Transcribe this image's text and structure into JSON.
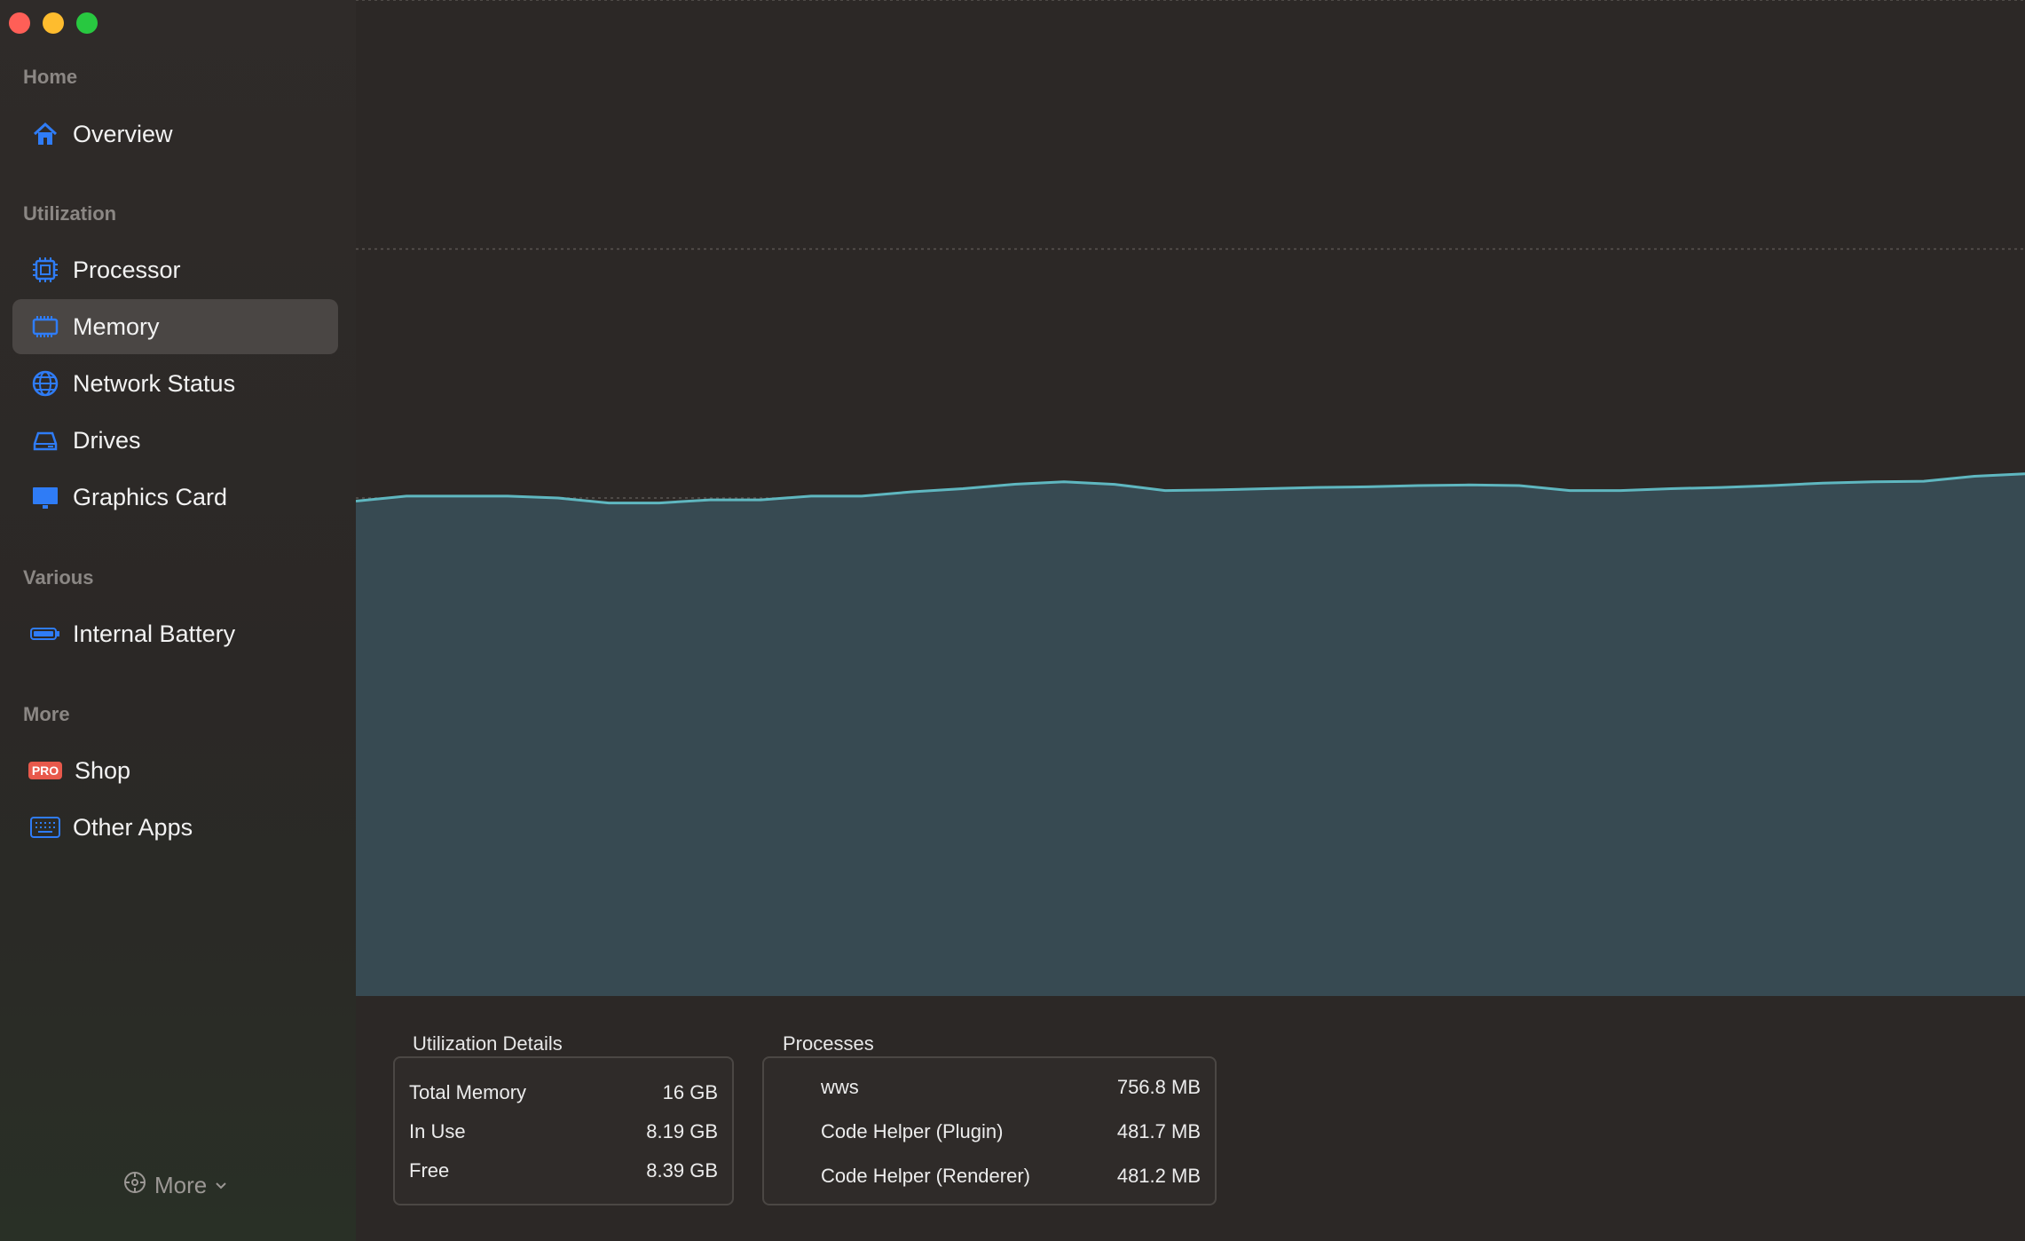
{
  "sidebar": {
    "sections": [
      {
        "label": "Home",
        "items": [
          {
            "label": "Overview",
            "icon": "house-icon"
          }
        ]
      },
      {
        "label": "Utilization",
        "items": [
          {
            "label": "Processor",
            "icon": "cpu-icon"
          },
          {
            "label": "Memory",
            "icon": "memory-icon"
          },
          {
            "label": "Network Status",
            "icon": "globe-icon"
          },
          {
            "label": "Drives",
            "icon": "drive-icon"
          },
          {
            "label": "Graphics Card",
            "icon": "display-icon"
          }
        ]
      },
      {
        "label": "Various",
        "items": [
          {
            "label": "Internal Battery",
            "icon": "battery-icon"
          }
        ]
      },
      {
        "label": "More",
        "items": [
          {
            "label": "Shop",
            "icon": "pro-badge-icon",
            "badge": "PRO"
          },
          {
            "label": "Other Apps",
            "icon": "keyboard-icon"
          }
        ]
      }
    ],
    "selected": "Memory",
    "more_label": "More"
  },
  "chart_data": {
    "type": "area",
    "title": "",
    "xlabel": "",
    "ylabel": "",
    "ylim": [
      0,
      16
    ],
    "grid": true,
    "series": [
      {
        "values": [
          7.95,
          8.03,
          8.03,
          8.03,
          8.0,
          7.92,
          7.92,
          7.97,
          7.97,
          8.03,
          8.03,
          8.1,
          8.15,
          8.22,
          8.26,
          8.22,
          8.12,
          8.13,
          8.15,
          8.17,
          8.18,
          8.2,
          8.21,
          8.2,
          8.12,
          8.12,
          8.15,
          8.17,
          8.2,
          8.24,
          8.26,
          8.27,
          8.35,
          8.39
        ]
      }
    ],
    "colors": {
      "line": "#5fb7c0",
      "fill": "#374a52"
    }
  },
  "utilization": {
    "title": "Utilization Details",
    "rows": [
      {
        "label": "Total Memory",
        "value": "16 GB"
      },
      {
        "label": "In Use",
        "value": "8.19 GB"
      },
      {
        "label": "Free",
        "value": "8.39 GB"
      }
    ]
  },
  "processes": {
    "title": "Processes",
    "rows": [
      {
        "name": "wws",
        "value": "756.8 MB"
      },
      {
        "name": "Code Helper (Plugin)",
        "value": "481.7 MB"
      },
      {
        "name": "Code Helper (Renderer)",
        "value": "481.2 MB"
      }
    ]
  },
  "colors": {
    "accent": "#2f7cf6",
    "selected_bg": "#4a4644",
    "pro_badge": "#e8594b"
  }
}
